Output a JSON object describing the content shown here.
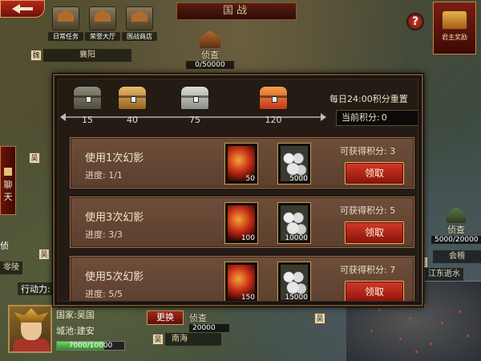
{
  "header": {
    "title": "国战",
    "icons": [
      {
        "label": "日常任务",
        "name": "daily-tasks"
      },
      {
        "label": "荣誉大厅",
        "name": "honor-hall"
      },
      {
        "label": "国战商店",
        "name": "war-shop"
      }
    ],
    "help_label": "?",
    "lord_reward_label": "君主奖励"
  },
  "map": {
    "city_top": {
      "kingdom": "魏",
      "name": "襄阳"
    },
    "scout_top": {
      "title": "侦查",
      "value": "0/50000"
    },
    "left_kingdom": "吴",
    "left_scout": "侦",
    "left_city": "零陵",
    "right_scout": {
      "title": "侦查",
      "value": "5000/20000"
    },
    "right_city": "会稽",
    "right_kingdom": "吴",
    "right_note": "江东逝水",
    "bottom_scout": {
      "title": "侦查",
      "value": "20000"
    },
    "bottom_city_kingdom": "吴",
    "bottom_city": "南海",
    "bottom_right_kingdom": "吴",
    "side_tab": "聊天"
  },
  "player": {
    "actions_label": "行动力:",
    "kingdom_line": "国家:吴国",
    "city_line": "城池:建安",
    "troops": "7000/10000",
    "troops_pct": 70,
    "switch_label": "更换"
  },
  "panel": {
    "reset_text": "每日24:00积分重置",
    "score_label": "当前积分:",
    "score_value": "0",
    "chests": [
      {
        "threshold": "15",
        "tier": "bronze"
      },
      {
        "threshold": "40",
        "tier": "gold"
      },
      {
        "threshold": "75",
        "tier": "silver"
      },
      {
        "threshold": "120",
        "tier": "red"
      }
    ],
    "tasks": [
      {
        "title": "使用1次幻影",
        "progress": "进度: 1/1",
        "flag_qty": "50",
        "coin_qty": "5000",
        "points": "可获得积分: 3",
        "button": "领取"
      },
      {
        "title": "使用3次幻影",
        "progress": "进度: 3/3",
        "flag_qty": "100",
        "coin_qty": "10000",
        "points": "可获得积分: 5",
        "button": "领取"
      },
      {
        "title": "使用5次幻影",
        "progress": "进度: 5/5",
        "flag_qty": "150",
        "coin_qty": "15000",
        "points": "可获得积分: 7",
        "button": "领取"
      }
    ]
  },
  "colors": {
    "accent_red": "#c22a14",
    "panel_row": "#6e4e3a",
    "gold_border": "#c89a4a"
  }
}
